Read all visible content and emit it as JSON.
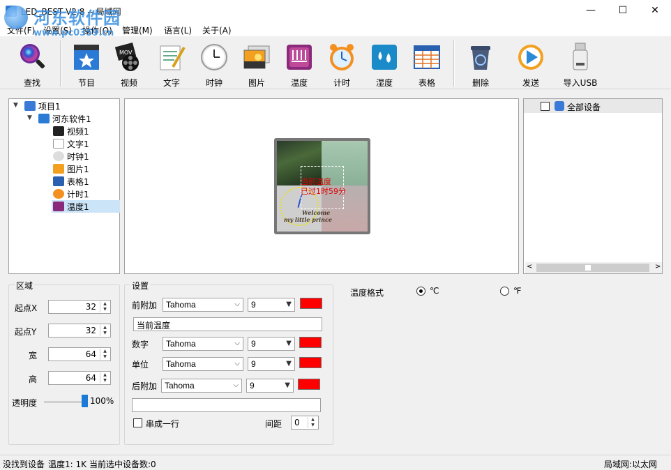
{
  "window": {
    "title": "LED_BEST V2.8 -- 局域网",
    "watermark_big": "河东软件园",
    "watermark_small": "www.pc0359.cn",
    "minimize": "—",
    "maximize": "☐",
    "close": "✕"
  },
  "menu": [
    "文件(F)",
    "设置(S)",
    "操作(O)",
    "管理(M)",
    "语言(L)",
    "关于(A)"
  ],
  "toolbar": {
    "buttons": [
      {
        "label": "查找",
        "icon": "search-icon"
      },
      {
        "label": "节目",
        "icon": "program-icon"
      },
      {
        "label": "视频",
        "icon": "video-icon"
      },
      {
        "label": "文字",
        "icon": "text-icon"
      },
      {
        "label": "时钟",
        "icon": "clock-icon"
      },
      {
        "label": "图片",
        "icon": "picture-icon"
      },
      {
        "label": "温度",
        "icon": "temperature-icon"
      },
      {
        "label": "计时",
        "icon": "timer-icon"
      },
      {
        "label": "湿度",
        "icon": "humidity-icon"
      },
      {
        "label": "表格",
        "icon": "table-icon"
      },
      {
        "label": "删除",
        "icon": "delete-icon"
      },
      {
        "label": "发送",
        "icon": "send-icon"
      },
      {
        "label": "导入USB",
        "icon": "usb-icon"
      }
    ]
  },
  "tree": {
    "project": "项目1",
    "program": "河东软件1",
    "items": [
      {
        "label": "视频1",
        "icon": "video-icon"
      },
      {
        "label": "文字1",
        "icon": "text-icon"
      },
      {
        "label": "时钟1",
        "icon": "clock-icon"
      },
      {
        "label": "图片1",
        "icon": "picture-icon"
      },
      {
        "label": "表格1",
        "icon": "table-icon"
      },
      {
        "label": "计时1",
        "icon": "timer-icon"
      },
      {
        "label": "温度1",
        "icon": "temperature-icon",
        "selected": true
      }
    ]
  },
  "preview": {
    "text_line1": "当前温度",
    "text_line2": "已过1时59分",
    "welcome1": "Welcome",
    "welcome2": "my little prince"
  },
  "devices": {
    "all": "全部设备",
    "scroll_left": "<",
    "scroll_right": ">"
  },
  "region": {
    "title": "区域",
    "start_x_label": "起点X",
    "start_x": "32",
    "start_y_label": "起点Y",
    "start_y": "32",
    "width_label": "宽",
    "width": "64",
    "height_label": "高",
    "height": "64",
    "opacity_label": "透明度",
    "opacity_value": "100%",
    "opacity_level": 100
  },
  "settings": {
    "title": "设置",
    "prefix_label": "前附加",
    "prefix_font": "Tahoma",
    "prefix_size": "9",
    "prefix_text": "当前温度",
    "number_label": "数字",
    "number_font": "Tahoma",
    "number_size": "9",
    "unit_label": "单位",
    "unit_font": "Tahoma",
    "unit_size": "9",
    "suffix_label": "后附加",
    "suffix_font": "Tahoma",
    "suffix_size": "9",
    "suffix_text": "",
    "single_line_label": "串成一行",
    "spacing_label": "间距",
    "spacing": "0",
    "color": "#ff0000"
  },
  "temp_format": {
    "label": "温度格式",
    "celsius": "℃",
    "fahrenheit": "℉"
  },
  "status": {
    "device": "没找到设备",
    "temp": "温度1: 1K",
    "selected": "当前选中设备数:0",
    "network": "局域网:以太网"
  }
}
